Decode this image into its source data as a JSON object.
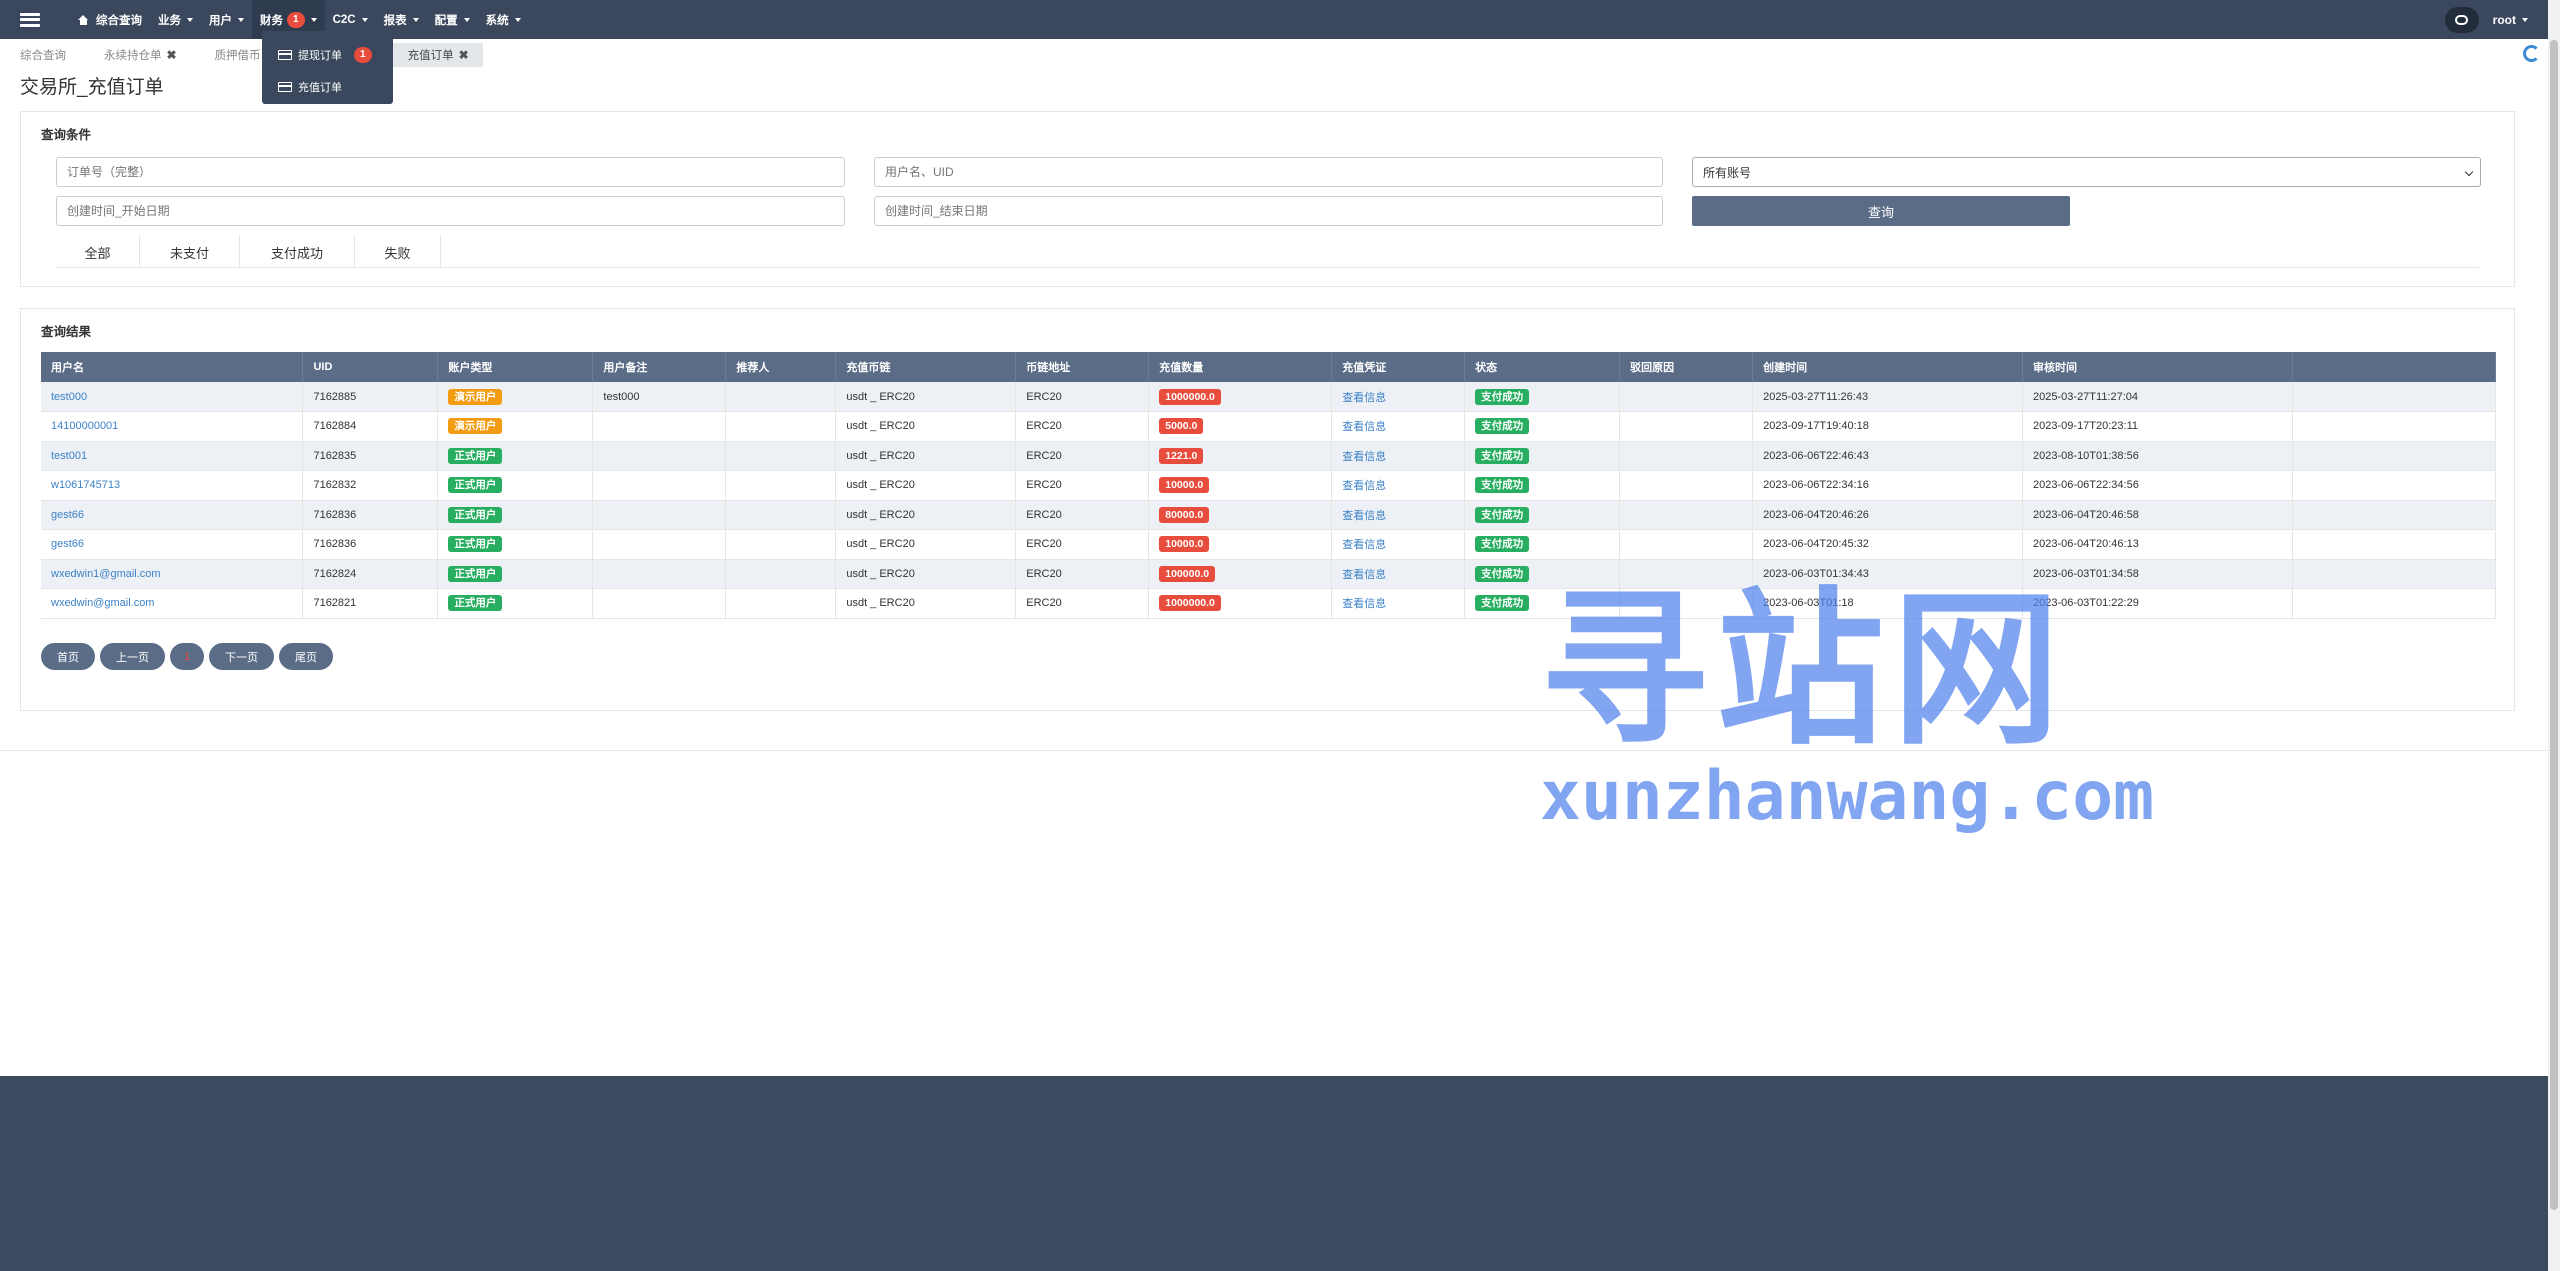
{
  "navbar": {
    "items": [
      {
        "label": "综合查询",
        "icon": "home-icon"
      },
      {
        "label": "业务"
      },
      {
        "label": "用户"
      },
      {
        "label": "财务",
        "badge": "1"
      },
      {
        "label": "C2C"
      },
      {
        "label": "报表"
      },
      {
        "label": "配置"
      },
      {
        "label": "系统"
      }
    ],
    "user": "root"
  },
  "finance_dropdown": {
    "items": [
      {
        "label": "提现订单",
        "badge": "1"
      },
      {
        "label": "充值订单"
      }
    ]
  },
  "tabs": [
    {
      "label": "综合查询"
    },
    {
      "label": "永续持仓单"
    },
    {
      "label": "质押借币"
    },
    {
      "label": "充值订单"
    }
  ],
  "page_title": "交易所_充值订单",
  "query": {
    "title": "查询条件",
    "order_no_placeholder": "订单号（完整）",
    "user_placeholder": "用户名、UID",
    "account_select": "所有账号",
    "start_placeholder": "创建时间_开始日期",
    "end_placeholder": "创建时间_结束日期",
    "submit_label": "查询",
    "status_tabs": [
      "全部",
      "未支付",
      "支付成功",
      "失败"
    ]
  },
  "results": {
    "title": "查询结果",
    "columns": [
      "用户名",
      "UID",
      "账户类型",
      "用户备注",
      "推荐人",
      "充值币链",
      "币链地址",
      "充值数量",
      "充值凭证",
      "状态",
      "驳回原因",
      "创建时间",
      "审核时间",
      ""
    ],
    "rows": [
      {
        "username": "test000",
        "uid": "7162885",
        "type": "演示用户",
        "type_color": "orange",
        "remark": "test000",
        "referrer": "",
        "chain": "usdt _ ERC20",
        "address": "ERC20",
        "amount": "1000000.0",
        "voucher": "查看信息",
        "status": "支付成功",
        "reason": "",
        "created": "2025-03-27T11:26:43",
        "reviewed": "2025-03-27T11:27:04"
      },
      {
        "username": "14100000001",
        "uid": "7162884",
        "type": "演示用户",
        "type_color": "orange",
        "remark": "",
        "referrer": "",
        "chain": "usdt _ ERC20",
        "address": "ERC20",
        "amount": "5000.0",
        "voucher": "查看信息",
        "status": "支付成功",
        "reason": "",
        "created": "2023-09-17T19:40:18",
        "reviewed": "2023-09-17T20:23:11"
      },
      {
        "username": "test001",
        "uid": "7162835",
        "type": "正式用户",
        "type_color": "green",
        "remark": "",
        "referrer": "",
        "chain": "usdt _ ERC20",
        "address": "ERC20",
        "amount": "1221.0",
        "voucher": "查看信息",
        "status": "支付成功",
        "reason": "",
        "created": "2023-06-06T22:46:43",
        "reviewed": "2023-08-10T01:38:56"
      },
      {
        "username": "w1061745713",
        "uid": "7162832",
        "type": "正式用户",
        "type_color": "green",
        "remark": "",
        "referrer": "",
        "chain": "usdt _ ERC20",
        "address": "ERC20",
        "amount": "10000.0",
        "voucher": "查看信息",
        "status": "支付成功",
        "reason": "",
        "created": "2023-06-06T22:34:16",
        "reviewed": "2023-06-06T22:34:56"
      },
      {
        "username": "gest66",
        "uid": "7162836",
        "type": "正式用户",
        "type_color": "green",
        "remark": "",
        "referrer": "",
        "chain": "usdt _ ERC20",
        "address": "ERC20",
        "amount": "80000.0",
        "voucher": "查看信息",
        "status": "支付成功",
        "reason": "",
        "created": "2023-06-04T20:46:26",
        "reviewed": "2023-06-04T20:46:58"
      },
      {
        "username": "gest66",
        "uid": "7162836",
        "type": "正式用户",
        "type_color": "green",
        "remark": "",
        "referrer": "",
        "chain": "usdt _ ERC20",
        "address": "ERC20",
        "amount": "10000.0",
        "voucher": "查看信息",
        "status": "支付成功",
        "reason": "",
        "created": "2023-06-04T20:45:32",
        "reviewed": "2023-06-04T20:46:13"
      },
      {
        "username": "wxedwin1@gmail.com",
        "uid": "7162824",
        "type": "正式用户",
        "type_color": "green",
        "remark": "",
        "referrer": "",
        "chain": "usdt _ ERC20",
        "address": "ERC20",
        "amount": "100000.0",
        "voucher": "查看信息",
        "status": "支付成功",
        "reason": "",
        "created": "2023-06-03T01:34:43",
        "reviewed": "2023-06-03T01:34:58"
      },
      {
        "username": "wxedwin@gmail.com",
        "uid": "7162821",
        "type": "正式用户",
        "type_color": "green",
        "remark": "",
        "referrer": "",
        "chain": "usdt _ ERC20",
        "address": "ERC20",
        "amount": "1000000.0",
        "voucher": "查看信息",
        "status": "支付成功",
        "reason": "",
        "created": "2023-06-03T01:18",
        "reviewed": "2023-06-03T01:22:29"
      }
    ]
  },
  "pagination": {
    "first": "首页",
    "prev": "上一页",
    "current": "1",
    "next": "下一页",
    "last": "尾页"
  },
  "watermark": {
    "cn": "寻站网",
    "en": "xunzhanwang.com"
  },
  "colors": {
    "navbar": "#3a475c",
    "table_header": "#5b6c87",
    "link": "#3c82c8",
    "green": "#27ae60",
    "orange": "#f39c12",
    "red": "#e74c3c"
  }
}
